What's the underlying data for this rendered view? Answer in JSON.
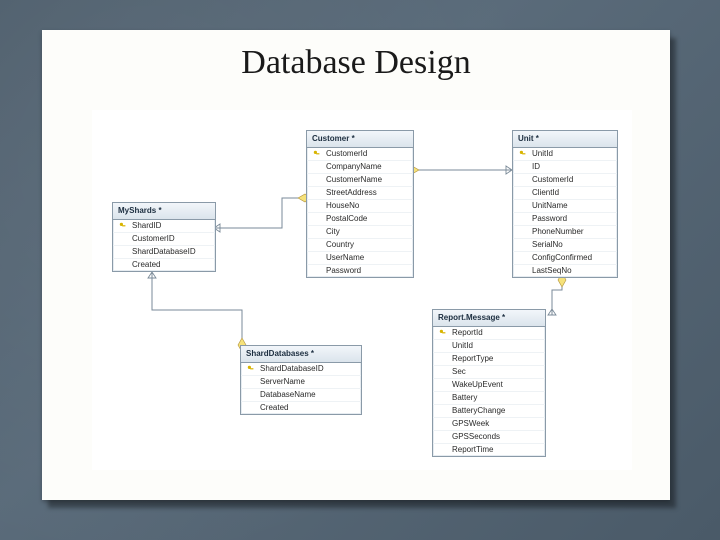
{
  "title": "Database Design",
  "tables": {
    "myshards": {
      "name": "MyShards *",
      "columns": [
        {
          "pk": true,
          "name": "ShardID"
        },
        {
          "pk": false,
          "name": "CustomerID"
        },
        {
          "pk": false,
          "name": "ShardDatabaseID"
        },
        {
          "pk": false,
          "name": "Created"
        }
      ]
    },
    "customer": {
      "name": "Customer *",
      "columns": [
        {
          "pk": true,
          "name": "CustomerId"
        },
        {
          "pk": false,
          "name": "CompanyName"
        },
        {
          "pk": false,
          "name": "CustomerName"
        },
        {
          "pk": false,
          "name": "StreetAddress"
        },
        {
          "pk": false,
          "name": "HouseNo"
        },
        {
          "pk": false,
          "name": "PostalCode"
        },
        {
          "pk": false,
          "name": "City"
        },
        {
          "pk": false,
          "name": "Country"
        },
        {
          "pk": false,
          "name": "UserName"
        },
        {
          "pk": false,
          "name": "Password"
        }
      ]
    },
    "unit": {
      "name": "Unit *",
      "columns": [
        {
          "pk": true,
          "name": "UnitId"
        },
        {
          "pk": false,
          "name": "ID"
        },
        {
          "pk": false,
          "name": "CustomerId"
        },
        {
          "pk": false,
          "name": "ClientId"
        },
        {
          "pk": false,
          "name": "UnitName"
        },
        {
          "pk": false,
          "name": "Password"
        },
        {
          "pk": false,
          "name": "PhoneNumber"
        },
        {
          "pk": false,
          "name": "SerialNo"
        },
        {
          "pk": false,
          "name": "ConfigConfirmed"
        },
        {
          "pk": false,
          "name": "LastSeqNo"
        }
      ]
    },
    "sharddatabases": {
      "name": "ShardDatabases *",
      "columns": [
        {
          "pk": true,
          "name": "ShardDatabaseID"
        },
        {
          "pk": false,
          "name": "ServerName"
        },
        {
          "pk": false,
          "name": "DatabaseName"
        },
        {
          "pk": false,
          "name": "Created"
        }
      ]
    },
    "reportmessage": {
      "name": "Report.Message *",
      "columns": [
        {
          "pk": true,
          "name": "ReportId"
        },
        {
          "pk": false,
          "name": "UnitId"
        },
        {
          "pk": false,
          "name": "ReportType"
        },
        {
          "pk": false,
          "name": "Sec"
        },
        {
          "pk": false,
          "name": "WakeUpEvent"
        },
        {
          "pk": false,
          "name": "Battery"
        },
        {
          "pk": false,
          "name": "BatteryChange"
        },
        {
          "pk": false,
          "name": "GPSWeek"
        },
        {
          "pk": false,
          "name": "GPSSeconds"
        },
        {
          "pk": false,
          "name": "ReportTime"
        }
      ]
    }
  },
  "relations": [
    {
      "from": "myshards.CustomerID",
      "to": "customer.CustomerId"
    },
    {
      "from": "unit.CustomerId",
      "to": "customer.CustomerId"
    },
    {
      "from": "myshards.ShardDatabaseID",
      "to": "sharddatabases.ShardDatabaseID"
    },
    {
      "from": "reportmessage.UnitId",
      "to": "unit.UnitId"
    }
  ]
}
